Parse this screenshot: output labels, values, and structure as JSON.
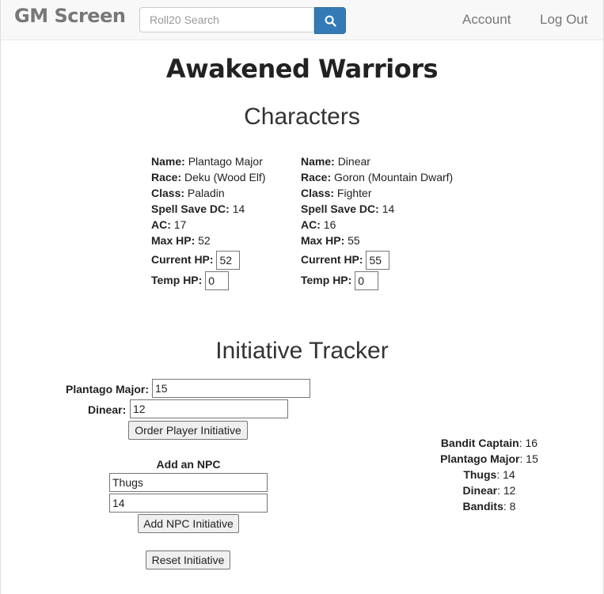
{
  "nav": {
    "brand": "GM Screen",
    "search_placeholder": "Roll20 Search",
    "account": "Account",
    "logout": "Log Out"
  },
  "page": {
    "title": "Awakened Warriors",
    "characters_heading": "Characters",
    "initiative_heading": "Initiative Tracker"
  },
  "labels": {
    "name": "Name:",
    "race": "Race:",
    "class": "Class:",
    "spell_save_dc": "Spell Save DC:",
    "ac": "AC:",
    "max_hp": "Max HP:",
    "current_hp": "Current HP:",
    "temp_hp": "Temp HP:"
  },
  "characters": [
    {
      "name": "Plantago Major",
      "race": "Deku (Wood Elf)",
      "class": "Paladin",
      "spell_save_dc": "14",
      "ac": "17",
      "max_hp": "52",
      "current_hp": "52",
      "temp_hp": "0"
    },
    {
      "name": "Dinear",
      "race": "Goron (Mountain Dwarf)",
      "class": "Fighter",
      "spell_save_dc": "14",
      "ac": "16",
      "max_hp": "55",
      "current_hp": "55",
      "temp_hp": "0"
    }
  ],
  "initiative": {
    "players": [
      {
        "label": "Plantago Major:",
        "value": "15"
      },
      {
        "label": "Dinear:",
        "value": "12"
      }
    ],
    "order_button": "Order Player Initiative",
    "add_npc_heading": "Add an NPC",
    "npc_name_value": "Thugs",
    "npc_init_value": "14",
    "add_npc_button": "Add NPC Initiative",
    "reset_button": "Reset Initiative",
    "order": [
      {
        "name": "Bandit Captain",
        "value": ": 16"
      },
      {
        "name": "Plantago Major",
        "value": ": 15"
      },
      {
        "name": "Thugs",
        "value": ": 14"
      },
      {
        "name": "Dinear",
        "value": ": 12"
      },
      {
        "name": "Bandits",
        "value": ": 8"
      }
    ]
  },
  "colors": {
    "navbar_bg": "#f8f8f8",
    "search_button": "#337ab7"
  }
}
